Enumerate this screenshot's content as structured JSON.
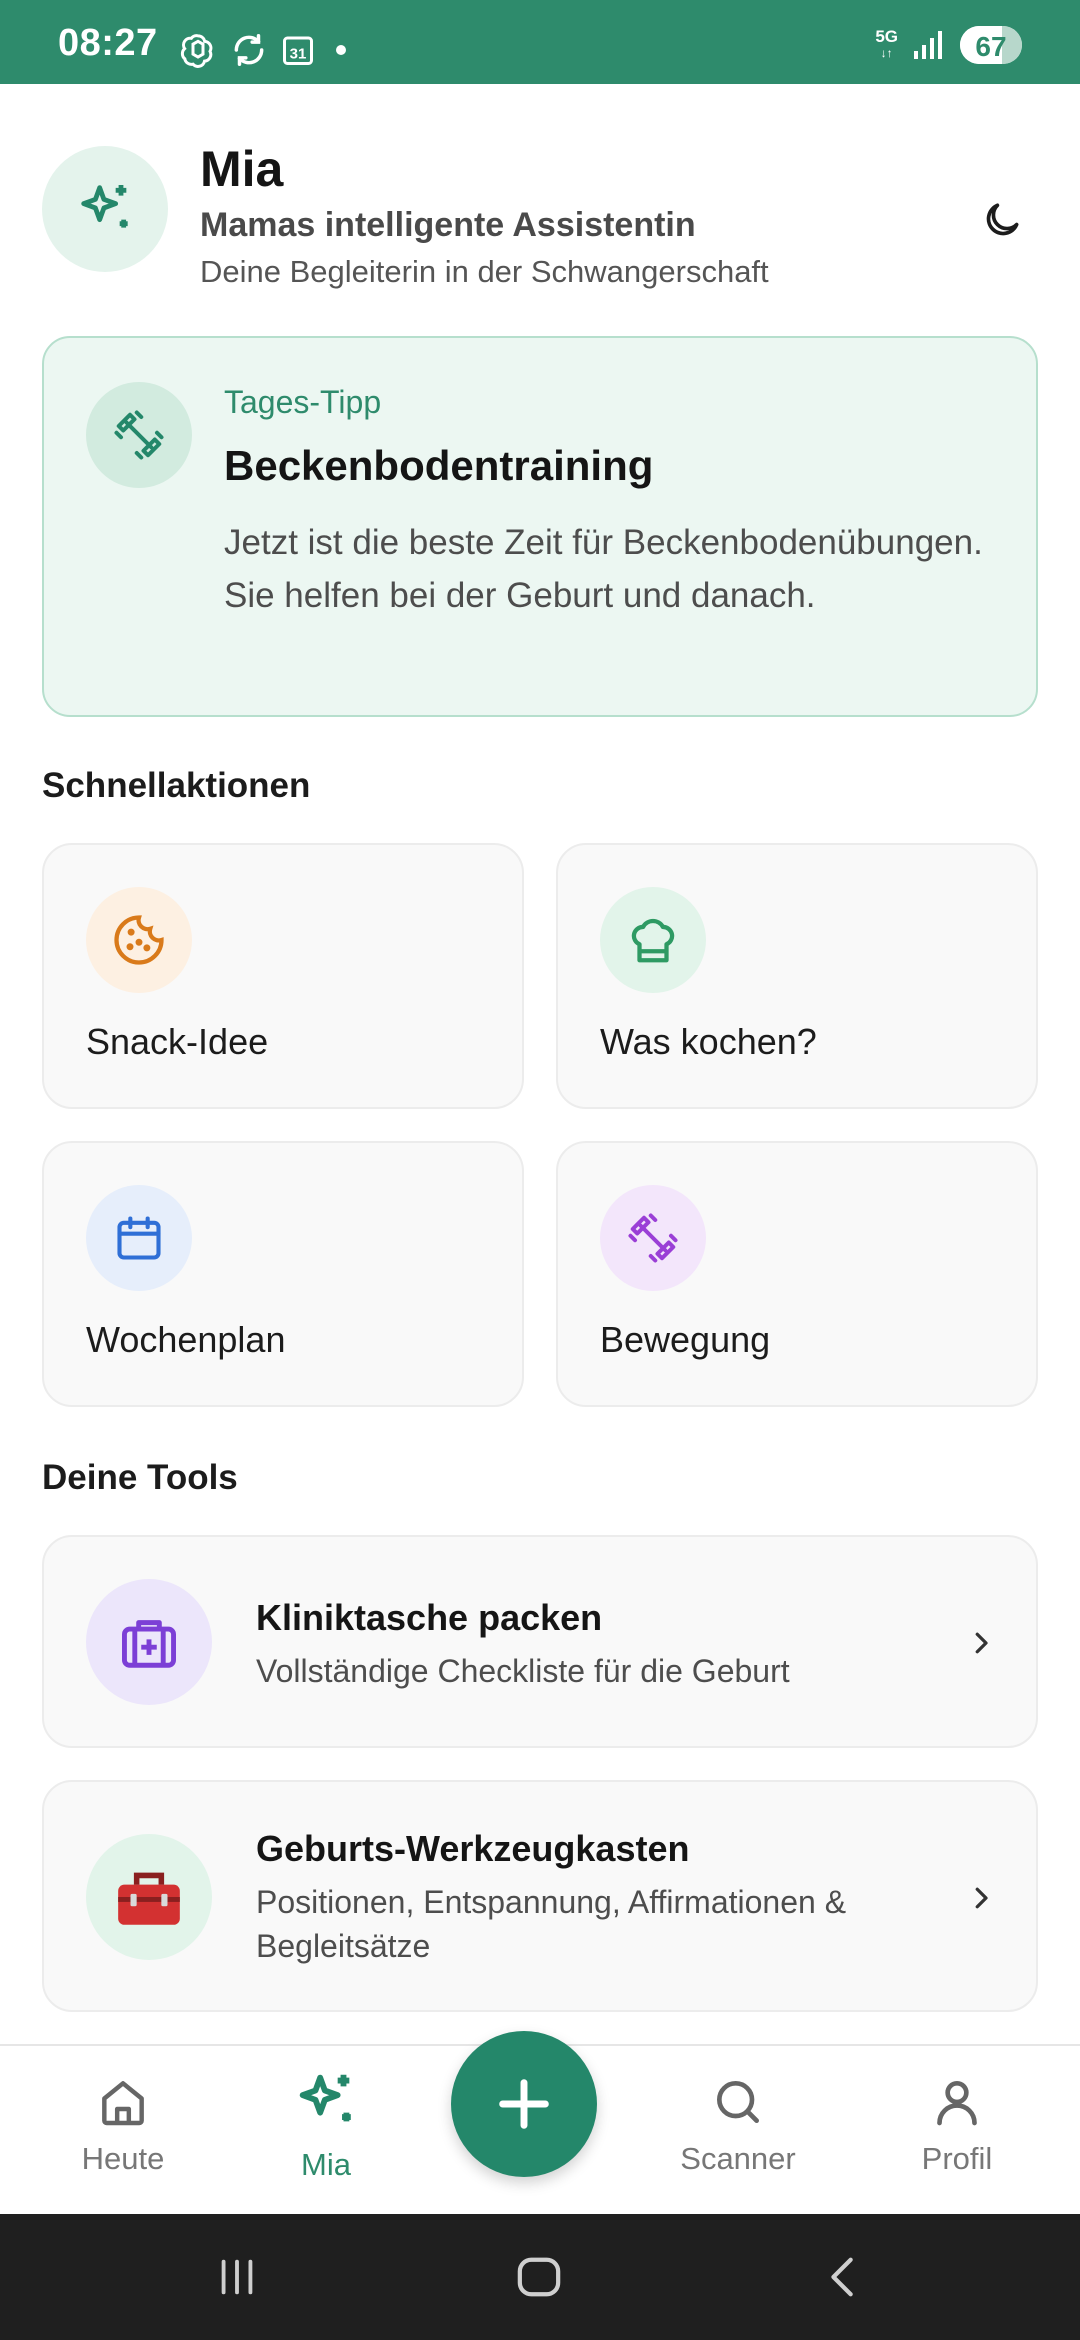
{
  "status_bar": {
    "time": "08:27",
    "calendar_day": "31",
    "network": "5G",
    "battery": "67"
  },
  "header": {
    "title": "Mia",
    "subtitle": "Mamas intelligente Assistentin",
    "tagline": "Deine Begleiterin in der Schwangerschaft"
  },
  "tip": {
    "label": "Tages-Tipp",
    "title": "Beckenbodentraining",
    "text": "Jetzt ist die beste Zeit für Beckenbodenübungen. Sie helfen bei der Geburt und danach."
  },
  "quick_actions": {
    "heading": "Schnellaktionen",
    "items": [
      {
        "label": "Snack-Idee",
        "icon": "cookie-icon",
        "color": "#d97a1a",
        "bg": "#fdf0e2"
      },
      {
        "label": "Was kochen?",
        "icon": "chef-hat-icon",
        "color": "#2e9a63",
        "bg": "#e2f4ea"
      },
      {
        "label": "Wochenplan",
        "icon": "calendar-icon",
        "color": "#2f6fd6",
        "bg": "#e6eefb"
      },
      {
        "label": "Bewegung",
        "icon": "dumbbell-icon",
        "color": "#9a3fd6",
        "bg": "#f3e6fb"
      }
    ]
  },
  "tools": {
    "heading": "Deine Tools",
    "items": [
      {
        "title": "Kliniktasche packen",
        "subtitle": "Vollständige Checkliste für die Geburt",
        "icon": "medical-bag-icon"
      },
      {
        "title": "Geburts-Werkzeugkasten",
        "subtitle": "Positionen, Entspannung, Affirmationen & Begleitsätze",
        "icon": "toolbox-icon"
      }
    ]
  },
  "bottom_nav": {
    "items": [
      {
        "label": "Heute",
        "icon": "home-icon"
      },
      {
        "label": "Mia",
        "icon": "sparkles-icon",
        "active": true
      },
      {
        "label": "Scanner",
        "icon": "search-icon"
      },
      {
        "label": "Profil",
        "icon": "user-icon"
      }
    ]
  },
  "colors": {
    "brand": "#2e8b6c",
    "tip_bg": "#ecf7f2"
  }
}
